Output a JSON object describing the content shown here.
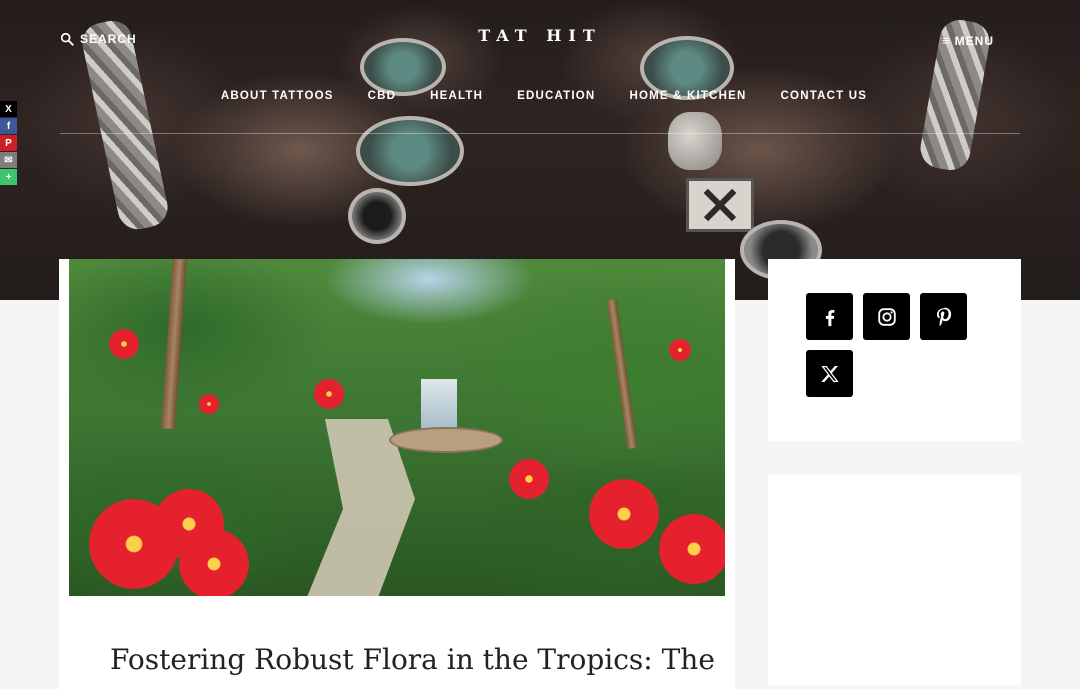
{
  "header": {
    "search_label": "SEARCH",
    "site_title": "TAT HIT",
    "menu_label": "MENU",
    "nav": [
      {
        "label": "ABOUT TATTOOS"
      },
      {
        "label": "CBD"
      },
      {
        "label": "HEALTH"
      },
      {
        "label": "EDUCATION"
      },
      {
        "label": "HOME & KITCHEN"
      },
      {
        "label": "CONTACT US"
      }
    ]
  },
  "share_bar": {
    "buttons": [
      {
        "icon": "x-icon",
        "glyph": "X",
        "color": "#000000"
      },
      {
        "icon": "facebook-icon",
        "glyph": "f",
        "color": "#3b5998"
      },
      {
        "icon": "pinterest-icon",
        "glyph": "P",
        "color": "#cb2027"
      },
      {
        "icon": "email-icon",
        "glyph": "✉",
        "color": "#7d7d7d"
      },
      {
        "icon": "more-icon",
        "glyph": "+",
        "color": "#3ec46d"
      }
    ]
  },
  "post": {
    "title": "Fostering Robust Flora in the Tropics: The"
  },
  "sidebar": {
    "social": [
      "facebook-icon",
      "instagram-icon",
      "pinterest-icon",
      "x-icon"
    ]
  }
}
